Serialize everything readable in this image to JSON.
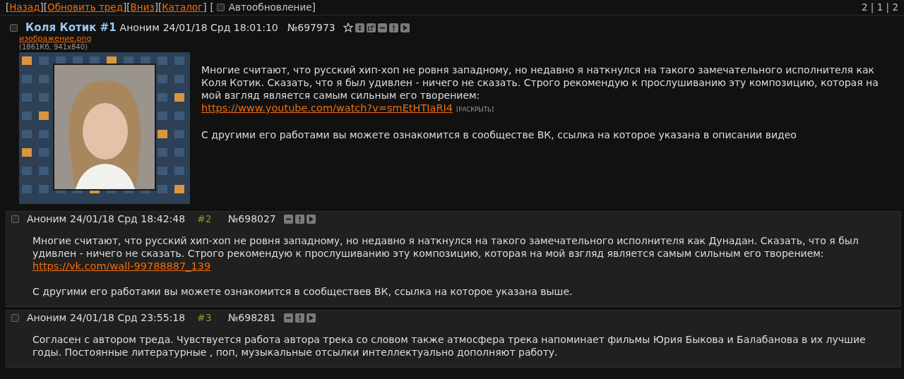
{
  "nav": {
    "links": [
      {
        "open": "[",
        "label": "Назад",
        "close": "]"
      },
      {
        "open": "[",
        "label": "Обновить тред",
        "close": "]"
      },
      {
        "open": "[",
        "label": "Вниз",
        "close": "]"
      },
      {
        "open": "[",
        "label": "Каталог",
        "close": "]"
      }
    ],
    "autoupdate": {
      "open": "[",
      "label": "Автообновление",
      "close": "]",
      "checked": false
    },
    "pages": "2 | 1 | 2"
  },
  "posts": [
    {
      "kind": "op",
      "checked": false,
      "subject": "Коля Котик #1",
      "author": "Аноним",
      "date": "24/01/18 Срд 18:01:10",
      "number": "№697973",
      "file": {
        "name": "изображение.png",
        "info": "(1861Кб, 941x840)",
        "kind": "picture"
      },
      "body": [
        {
          "kind": "text",
          "text": "Многие считают, что русский хип-хоп не ровня западному, но недавно я наткнулся на такого замечательного исполнителя как Коля Котик. Сказать, что я был удивлен - ничего не сказать. Строго рекомендую к прослушиванию эту композицию, которая на мой взгляд является самым сильным его творением:"
        },
        {
          "kind": "link",
          "url": "https://www.youtube.com/watch?v=smEtHTIaRI4",
          "expand": "[РАСКРЫТЬ]"
        },
        {
          "kind": "gap"
        },
        {
          "kind": "text",
          "text": "С другими его работами вы можете ознакомится в сообществе ВК, ссылка на которое указана в описании видео"
        }
      ]
    },
    {
      "kind": "reply",
      "checked": false,
      "author": "Аноним",
      "date": "24/01/18 Срд 18:42:48",
      "index": "#2",
      "number": "№698027",
      "body": [
        {
          "kind": "text",
          "text": "Многие считают, что русский хип-хоп не ровня западному, но недавно я наткнулся на такого замечательного исполнителя как Дунадан. Сказать, что я был удивлен - ничего не сказать. Строго рекомендую к прослушиванию эту композицию, которая на мой взгляд является самым сильным его творением:"
        },
        {
          "kind": "link",
          "url": "https://vk.com/wall-99788887_139"
        },
        {
          "kind": "gap"
        },
        {
          "kind": "text",
          "text": "С другими его работами вы можете ознакомится в сообществев ВК, ссылка на которое указана выше."
        }
      ]
    },
    {
      "kind": "reply",
      "checked": false,
      "author": "Аноним",
      "date": "24/01/18 Срд 23:55:18",
      "index": "#3",
      "number": "№698281",
      "body": [
        {
          "kind": "text",
          "text": "Согласен с автором треда. Чувствуется работа автора трека со словом также атмосфера трека напоминает фильмы Юрия Быкова и Балабанова в их лучшие годы. Постоянные литературные , поп, музыкальные отсылки интеллектуально дополняют работу."
        }
      ]
    }
  ]
}
